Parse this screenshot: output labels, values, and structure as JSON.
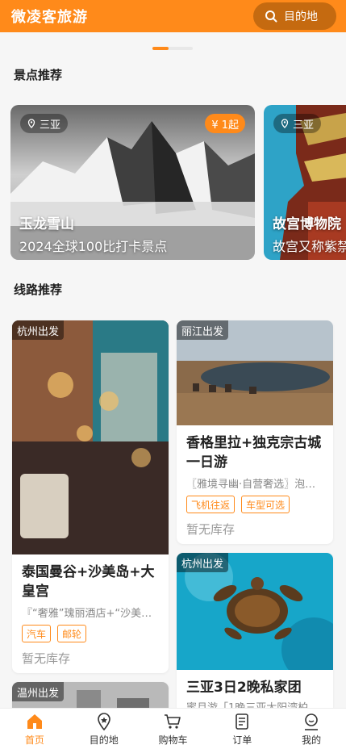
{
  "header": {
    "title": "微凌客旅游",
    "dest_button": "目的地"
  },
  "colors": {
    "accent": "#ff8a1a"
  },
  "sections": {
    "spots_title": "景点推荐",
    "routes_title": "线路推荐"
  },
  "spots": [
    {
      "location": "三亚",
      "price": "¥ 1起",
      "name": "玉龙雪山",
      "desc": "2024全球100比打卡景点"
    },
    {
      "location": "三亚",
      "name": "故宫博物院",
      "desc": "故宫又称紫禁城"
    }
  ],
  "routes": [
    {
      "from": "杭州出发",
      "name": "泰国曼谷+沙美岛+大皇宫",
      "sub": "『“奢雅”瑰丽酒店+“沙美岛…",
      "tags": [
        "汽车",
        "邮轮"
      ],
      "stock": "暂无库存"
    },
    {
      "from": "丽江出发",
      "name": "香格里拉+独克宗古城一日游",
      "sub": "〖雅境寻幽·自营奢选〗泡…",
      "tags": [
        "飞机往返",
        "车型可选"
      ],
      "stock": "暂无库存"
    },
    {
      "from": "杭州出发",
      "name": "三亚3日2晚私家团",
      "sub": "蜜月游「1晚三亚太阳湾柏…"
    },
    {
      "from": "温州出发"
    }
  ],
  "nav": [
    {
      "label": "首页",
      "icon": "home-icon",
      "active": true
    },
    {
      "label": "目的地",
      "icon": "location-icon"
    },
    {
      "label": "购物车",
      "icon": "cart-icon"
    },
    {
      "label": "订单",
      "icon": "order-icon"
    },
    {
      "label": "我的",
      "icon": "profile-icon"
    }
  ]
}
